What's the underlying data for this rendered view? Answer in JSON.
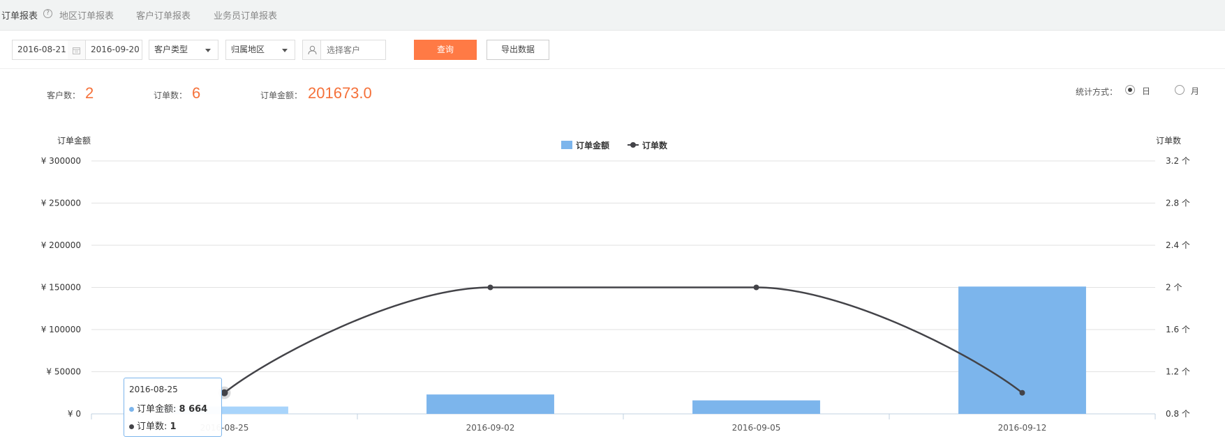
{
  "tabs": [
    {
      "label": "订单报表",
      "active": true
    },
    {
      "label": "地区订单报表",
      "active": false
    },
    {
      "label": "客户订单报表",
      "active": false
    },
    {
      "label": "业务员订单报表",
      "active": false
    }
  ],
  "help_symbol": "?",
  "toolbar": {
    "start_date": "2016-08-21",
    "end_date": "2016-09-20",
    "customer_type": "客户类型",
    "region": "归属地区",
    "customer_placeholder": "选择客户",
    "query_label": "查询",
    "export_label": "导出数据"
  },
  "stats": {
    "customers_label": "客户数：",
    "customers_value": "2",
    "orders_label": "订单数：",
    "orders_value": "6",
    "amount_label": "订单金额：",
    "amount_value": "201673.0"
  },
  "mode": {
    "label": "统计方式：",
    "options": [
      {
        "label": "日",
        "checked": true
      },
      {
        "label": "月",
        "checked": false
      }
    ]
  },
  "chart_data": {
    "type": "bar",
    "categories": [
      "2016-08-25",
      "2016-09-02",
      "2016-09-05",
      "2016-09-12"
    ],
    "series": [
      {
        "name": "订单金额",
        "type": "bar",
        "axis": "left",
        "color": "#7cb5ec",
        "values": [
          8664,
          23000,
          16000,
          151000
        ]
      },
      {
        "name": "订单数",
        "type": "line",
        "axis": "right",
        "color": "#434348",
        "values": [
          1,
          2,
          2,
          1
        ]
      }
    ],
    "y_left": {
      "label": "订单金额",
      "min": 0,
      "max": 300000,
      "ticks": [
        0,
        50000,
        100000,
        150000,
        200000,
        250000,
        300000
      ],
      "tick_labels": [
        "¥ 0",
        "¥ 50000",
        "¥ 100000",
        "¥ 150000",
        "¥ 200000",
        "¥ 250000",
        "¥ 300000"
      ]
    },
    "y_right": {
      "label": "订单数",
      "min": 0.8,
      "max": 3.2,
      "ticks": [
        0.8,
        1.2,
        1.6,
        2,
        2.4,
        2.8,
        3.2
      ],
      "tick_labels": [
        "0.8 个",
        "1.2 个",
        "1.6 个",
        "2 个",
        "2.4 个",
        "2.8 个",
        "3.2 个"
      ]
    },
    "legend": "top-center",
    "grid": true,
    "highlighted_category": "2016-08-25"
  },
  "tooltip": {
    "date": "2016-08-25",
    "amount_label": "订单金额: ",
    "amount_value": "8 664",
    "count_label": "订单数: ",
    "count_value": "1"
  }
}
